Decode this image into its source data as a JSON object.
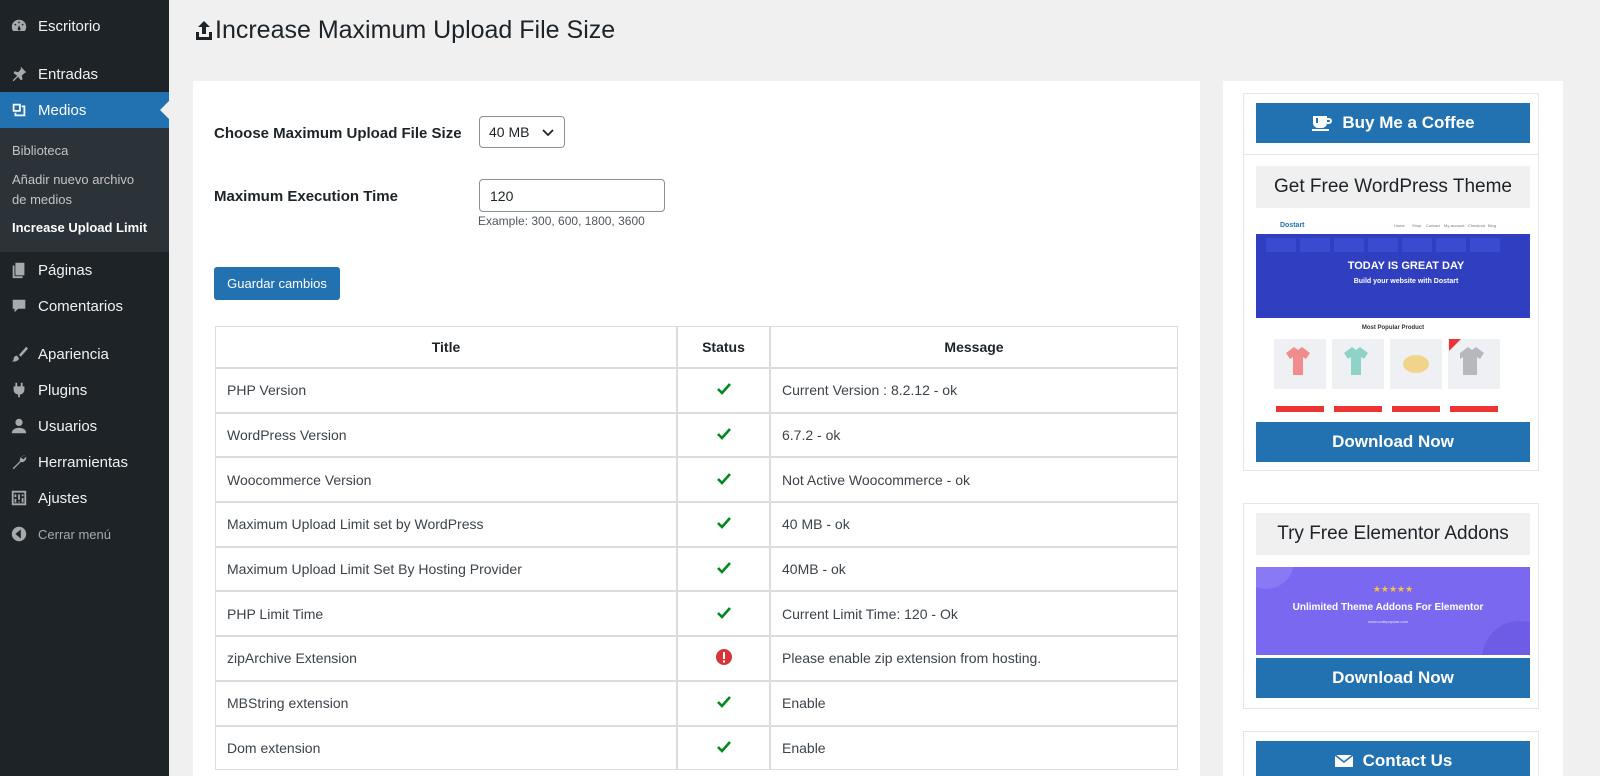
{
  "sidebar": {
    "items": [
      {
        "label": "Escritorio",
        "icon": "dashboard-icon"
      },
      {
        "label": "Entradas",
        "icon": "pin-icon"
      },
      {
        "label": "Medios",
        "icon": "media-icon"
      },
      {
        "label": "Páginas",
        "icon": "pages-icon"
      },
      {
        "label": "Comentarios",
        "icon": "comment-icon"
      },
      {
        "label": "Apariencia",
        "icon": "brush-icon"
      },
      {
        "label": "Plugins",
        "icon": "plugin-icon"
      },
      {
        "label": "Usuarios",
        "icon": "user-icon"
      },
      {
        "label": "Herramientas",
        "icon": "wrench-icon"
      },
      {
        "label": "Ajustes",
        "icon": "settings-icon"
      },
      {
        "label": "Cerrar menú",
        "icon": "collapse-icon"
      }
    ],
    "submenu": [
      {
        "label": "Biblioteca"
      },
      {
        "label": "Añadir nuevo archivo de medios"
      },
      {
        "label": "Increase Upload Limit"
      }
    ]
  },
  "page": {
    "title": "Increase Maximum Upload File Size"
  },
  "form": {
    "upload_size_label": "Choose Maximum Upload File Size",
    "upload_size_value": "40 MB",
    "exec_time_label": "Maximum Execution Time",
    "exec_time_value": "120",
    "exec_time_hint": "Example: 300, 600, 1800, 3600",
    "save_label": "Guardar cambios"
  },
  "table": {
    "headers": [
      "Title",
      "Status",
      "Message"
    ],
    "rows": [
      {
        "title": "PHP Version",
        "status": "ok",
        "message": "Current Version : 8.2.12 - ok"
      },
      {
        "title": "WordPress Version",
        "status": "ok",
        "message": "6.7.2 - ok"
      },
      {
        "title": "Woocommerce Version",
        "status": "ok",
        "message": "Not Active Woocommerce - ok"
      },
      {
        "title": "Maximum Upload Limit set by WordPress",
        "status": "ok",
        "message": "40 MB - ok"
      },
      {
        "title": "Maximum Upload Limit Set By Hosting Provider",
        "status": "ok",
        "message": "40MB - ok"
      },
      {
        "title": "PHP Limit Time",
        "status": "ok",
        "message": "Current Limit Time: 120 - Ok"
      },
      {
        "title": "zipArchive Extension",
        "status": "error",
        "message": "Please enable zip extension from hosting."
      },
      {
        "title": "MBString extension",
        "status": "ok",
        "message": "Enable"
      },
      {
        "title": "Dom extension",
        "status": "ok",
        "message": "Enable"
      }
    ]
  },
  "side": {
    "coffee_label": "Buy Me a Coffee",
    "theme_title": "Get Free WordPress Theme",
    "theme_download": "Download Now",
    "theme_preview": {
      "brand": "Dostart",
      "nav": [
        "Home",
        "Shop",
        "Contact",
        "My account",
        "Checkout",
        "Blog"
      ],
      "hero_title": "TODAY IS GREAT DAY",
      "hero_sub": "Build your website with Dostart",
      "section": "Most Popular Product"
    },
    "addons_title": "Try Free Elementor Addons",
    "addons_download": "Download Now",
    "addons_preview": {
      "stars": "★★★★★",
      "text": "Unlimited Theme Addons For Elementor",
      "url": "www.codepopular.com"
    },
    "contact_label": "Contact Us"
  },
  "colors": {
    "sidebar_bg": "#1d2327",
    "accent": "#2271b1",
    "success": "#008a20",
    "error": "#d63638"
  }
}
